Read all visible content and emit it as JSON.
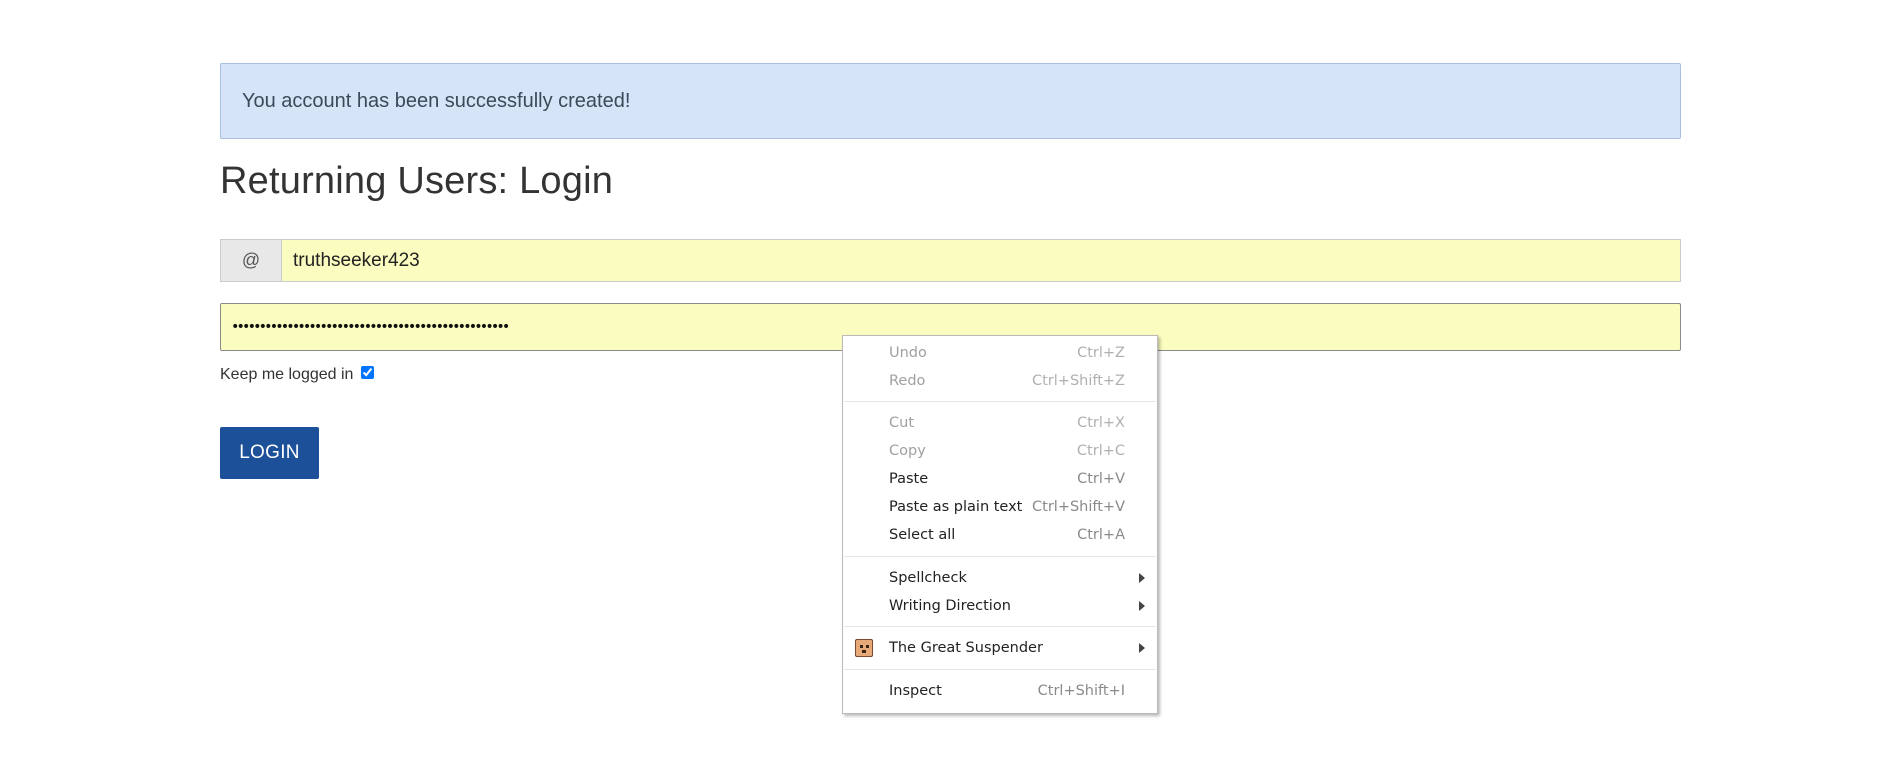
{
  "alert": {
    "message": "You account has been successfully created!"
  },
  "login": {
    "title": "Returning Users: Login",
    "username_addon": "@",
    "username_value": "truthseeker423",
    "password_value": "••••••••••••••••••••••••••••••••••••••••••••••••••",
    "keep_logged_in_label": "Keep me logged in",
    "keep_logged_in_checked": true,
    "button_label": "LOGIN"
  },
  "context_menu": {
    "undo": {
      "label": "Undo",
      "shortcut": "Ctrl+Z"
    },
    "redo": {
      "label": "Redo",
      "shortcut": "Ctrl+Shift+Z"
    },
    "cut": {
      "label": "Cut",
      "shortcut": "Ctrl+X"
    },
    "copy": {
      "label": "Copy",
      "shortcut": "Ctrl+C"
    },
    "paste": {
      "label": "Paste",
      "shortcut": "Ctrl+V"
    },
    "paste_plain": {
      "label": "Paste as plain text",
      "shortcut": "Ctrl+Shift+V"
    },
    "select_all": {
      "label": "Select all",
      "shortcut": "Ctrl+A"
    },
    "spellcheck": {
      "label": "Spellcheck"
    },
    "writing_direction": {
      "label": "Writing Direction"
    },
    "great_suspender": {
      "label": "The Great Suspender"
    },
    "inspect": {
      "label": "Inspect",
      "shortcut": "Ctrl+Shift+I"
    }
  },
  "colors": {
    "alert_bg": "#d6e4f8",
    "autofill_bg": "#fafcc0",
    "button_bg": "#1c5098"
  }
}
